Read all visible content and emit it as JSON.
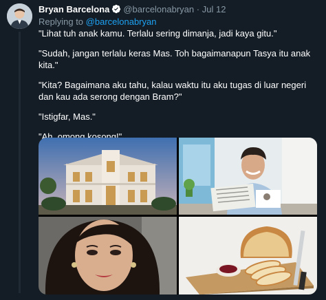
{
  "tweet": {
    "author_name": "Bryan Barcelona",
    "author_handle": "@barcelonabryan",
    "separator": "·",
    "date": "Jul 12",
    "reply_label": "Replying to ",
    "reply_handle": "@barcelonabryan",
    "paragraphs": [
      "\"Lihat tuh anak kamu. Terlalu sering dimanja, jadi kaya gitu.\"",
      "\"Sudah, jangan terlalu keras Mas. Toh bagaimanapun Tasya itu anak kita.\"",
      "\"Kita? Bagaimana aku tahu, kalau waktu itu aku tugas di luar negeri dan kau ada serong dengan Bram?\"",
      "\"Istigfar, Mas.\"",
      "\"Ah, omong kosong!\""
    ],
    "verified_icon": "verified-badge-icon",
    "accent_color": "#1da1f2",
    "background_color": "#141d26",
    "secondary_text_color": "#8899a6"
  },
  "media": {
    "images": [
      "mansion-photo",
      "man-reading-newspaper-photo",
      "woman-portrait-photo",
      "bread-and-jam-photo"
    ]
  }
}
